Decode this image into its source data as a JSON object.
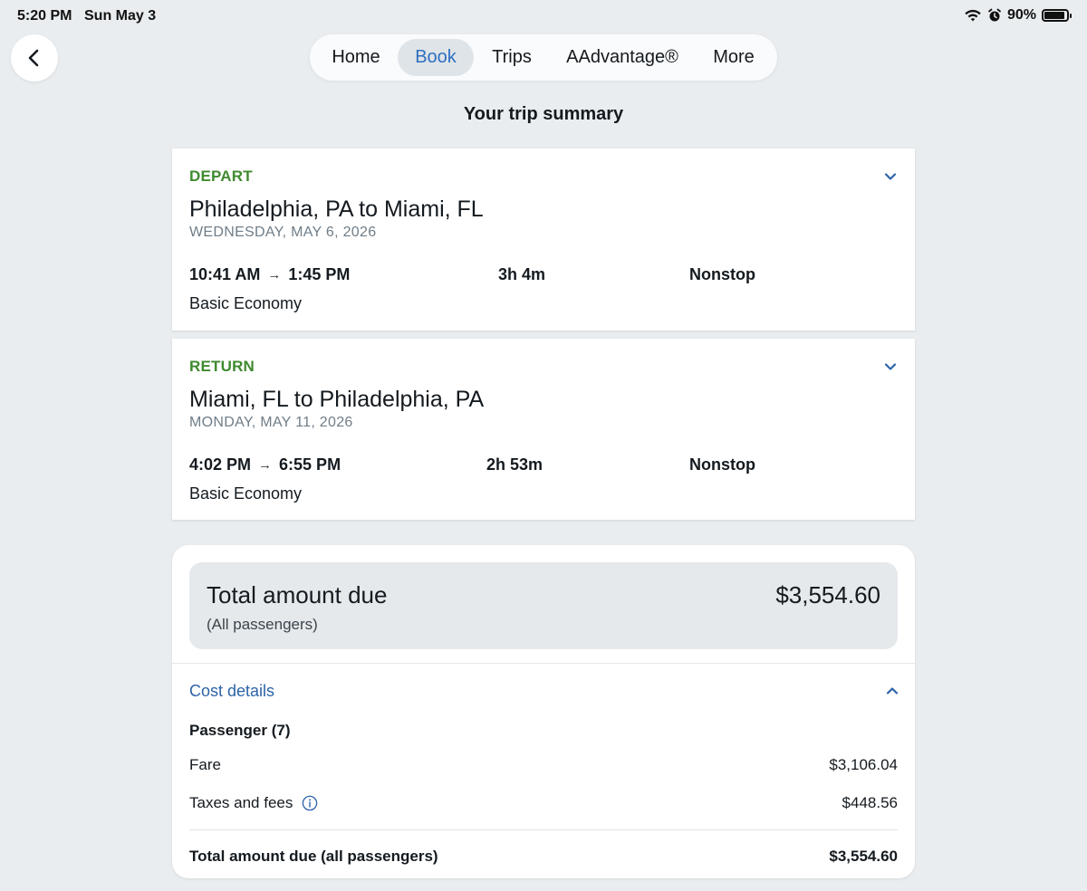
{
  "status_bar": {
    "time": "5:20 PM",
    "date": "Sun May 3",
    "battery_percent": "90%",
    "battery_level": 0.9,
    "icons": [
      "wifi-icon",
      "alarm-icon",
      "battery-icon"
    ]
  },
  "nav": {
    "back_icon": "chevron-left-icon",
    "items": [
      {
        "label": "Home",
        "selected": false
      },
      {
        "label": "Book",
        "selected": true
      },
      {
        "label": "Trips",
        "selected": false
      },
      {
        "label": "AAdvantage®",
        "selected": false
      },
      {
        "label": "More",
        "selected": false
      }
    ]
  },
  "page_title": "Your trip summary",
  "flights": [
    {
      "label": "DEPART",
      "route": "Philadelphia, PA to Miami, FL",
      "date": "WEDNESDAY, MAY 6, 2026",
      "depart_time": "10:41 AM",
      "arrive_time": "1:45 PM",
      "duration": "3h 4m",
      "stops": "Nonstop",
      "cabin": "Basic Economy"
    },
    {
      "label": "RETURN",
      "route": "Miami, FL to Philadelphia, PA",
      "date": "MONDAY, MAY 11, 2026",
      "depart_time": "4:02 PM",
      "arrive_time": "6:55 PM",
      "duration": "2h 53m",
      "stops": "Nonstop",
      "cabin": "Basic Economy"
    }
  ],
  "cost": {
    "total_label": "Total amount due",
    "total_amount": "$3,554.60",
    "total_sub": "(All passengers)",
    "details_label": "Cost details",
    "passenger_label": "Passenger (7)",
    "fare_label": "Fare",
    "fare_value": "$3,106.04",
    "taxes_label": "Taxes and fees",
    "taxes_value": "$448.56",
    "grand_label": "Total amount due (all passengers)",
    "grand_value": "$3,554.60"
  },
  "colors": {
    "background": "#e9edef",
    "accent_blue": "#2d6fc0",
    "label_green": "#3f8a2f",
    "date_gray": "#6f7d88"
  }
}
